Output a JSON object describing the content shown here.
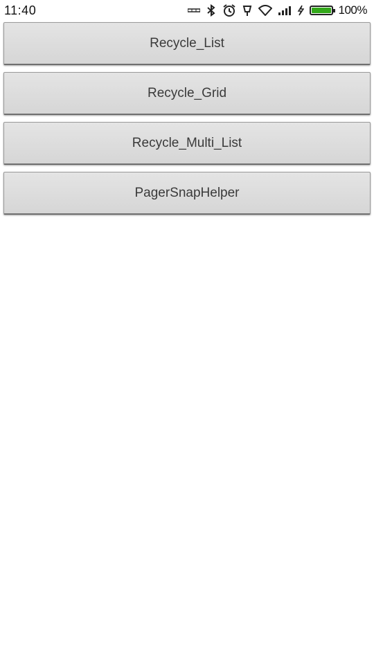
{
  "status_bar": {
    "time": "11:40",
    "icons": [
      "nfc-icon",
      "bluetooth-icon",
      "alarm-icon",
      "notification-icon",
      "wifi-icon",
      "signal-icon",
      "charging-icon"
    ],
    "battery_percent_label": "100%",
    "battery_level": 1.0,
    "battery_color": "#33a81a"
  },
  "buttons": {
    "recycle_list": "Recycle_List",
    "recycle_grid": "Recycle_Grid",
    "recycle_multi_list": "Recycle_Multi_List",
    "pager_snap_helper": "PagerSnapHelper"
  }
}
